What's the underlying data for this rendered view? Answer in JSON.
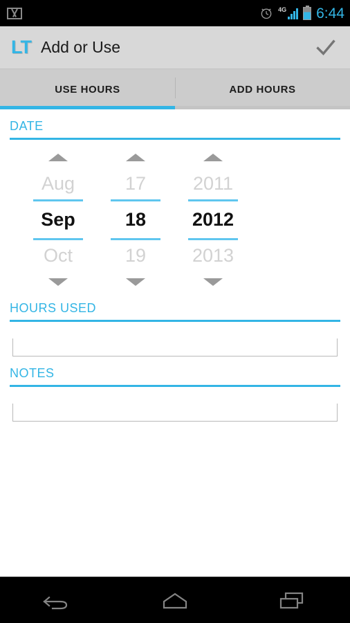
{
  "status_bar": {
    "notification_icon": "gmail-icon",
    "alarm_icon": "alarm-clock-icon",
    "network_label": "4G",
    "signal_icon": "signal-bars-icon",
    "battery_icon": "battery-icon",
    "time": "6:44",
    "accent": "#33b5e5"
  },
  "action_bar": {
    "logo": "LT",
    "title": "Add or Use",
    "done_icon": "checkmark-icon",
    "background": "#d8d8d8"
  },
  "tabs": [
    {
      "label": "USE HOURS",
      "active": true
    },
    {
      "label": "ADD HOURS",
      "active": false
    }
  ],
  "sections": {
    "date": {
      "header": "DATE",
      "picker": {
        "month": {
          "prev": "Aug",
          "selected": "Sep",
          "next": "Oct"
        },
        "day": {
          "prev": "17",
          "selected": "18",
          "next": "19"
        },
        "year": {
          "prev": "2011",
          "selected": "2012",
          "next": "2013"
        }
      }
    },
    "hours_used": {
      "header": "HOURS USED",
      "value": "",
      "placeholder": ""
    },
    "notes": {
      "header": "NOTES",
      "value": "",
      "placeholder": ""
    }
  },
  "nav_bar": {
    "back": "back-icon",
    "home": "home-icon",
    "recents": "recent-apps-icon"
  },
  "colors": {
    "accent_blue": "#33b5e5",
    "picker_rule": "#5fc6ef",
    "dim_text": "#d2d2d2",
    "tab_bar": "#cccccc"
  }
}
